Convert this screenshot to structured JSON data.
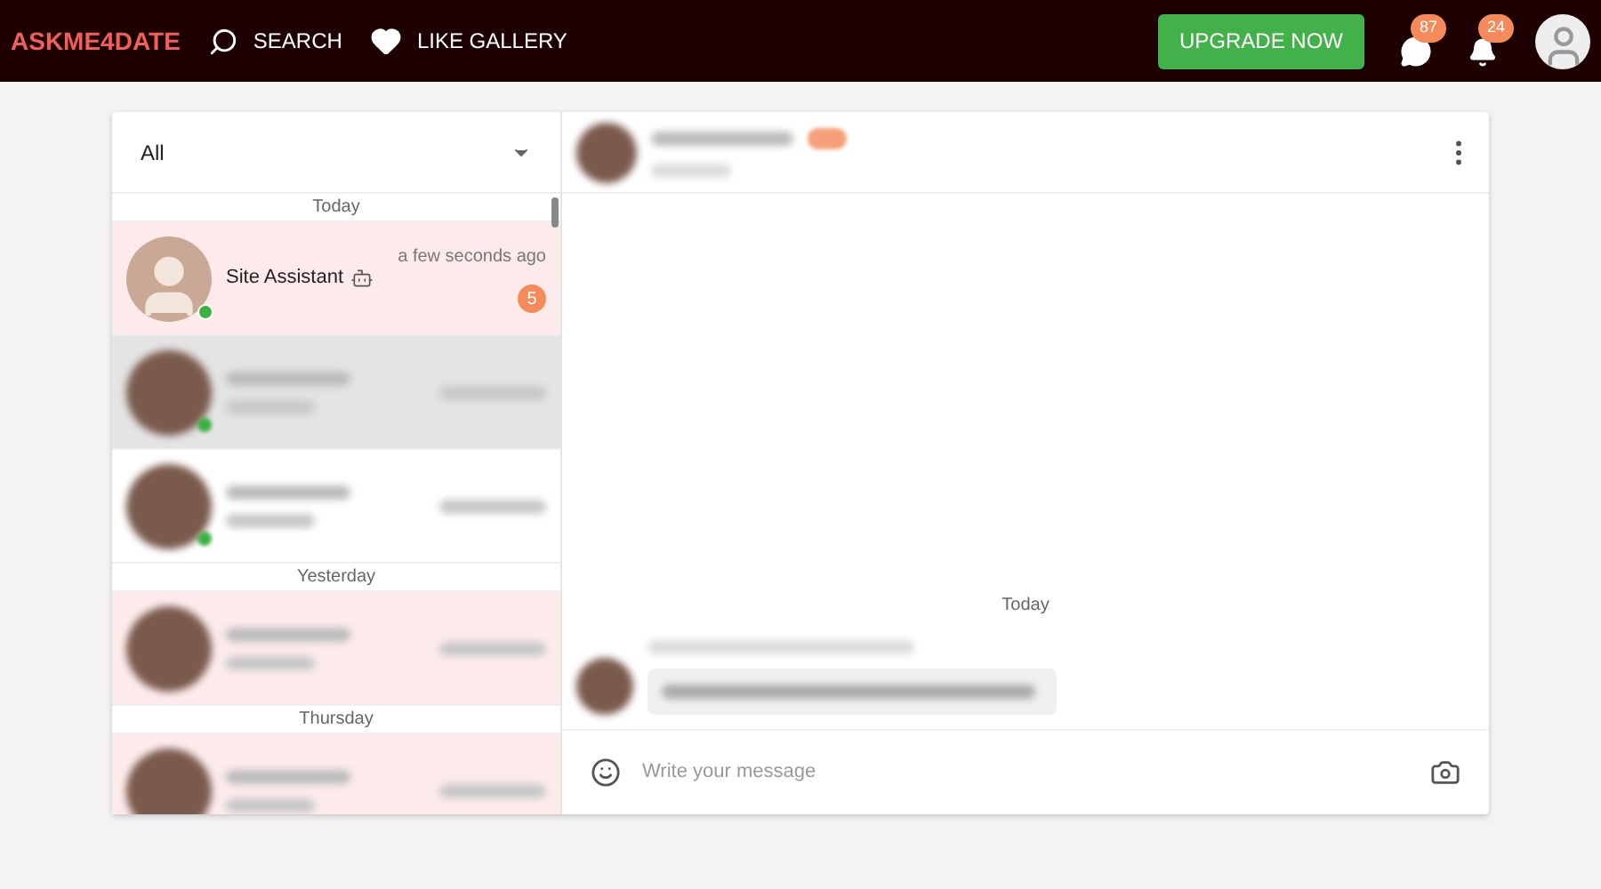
{
  "header": {
    "logo": "ASKME4DATE",
    "nav": [
      {
        "label": "SEARCH",
        "kind": "search"
      },
      {
        "label": "LIKE GALLERY",
        "kind": "heart"
      }
    ],
    "upgrade": "UPGRADE NOW",
    "messages_count": "87",
    "notifications_count": "24"
  },
  "filter": {
    "value": "All"
  },
  "groups": [
    {
      "label": "Today",
      "items": [
        {
          "kind": "contact",
          "name": "Site Assistant",
          "time": "a few seconds ago",
          "unread": "5",
          "online": true,
          "unread_tint": true,
          "bot": true
        },
        {
          "kind": "blurred",
          "selected": true,
          "online": true
        },
        {
          "kind": "blurred",
          "selected": false,
          "unread_tint": false,
          "online": true
        }
      ]
    },
    {
      "label": "Yesterday",
      "items": [
        {
          "kind": "blurred",
          "selected": false,
          "unread_tint": true,
          "online": false
        }
      ]
    },
    {
      "label": "Thursday",
      "items": [
        {
          "kind": "blurred",
          "selected": false,
          "unread_tint": true,
          "online": false
        }
      ]
    }
  ],
  "chat": {
    "day_label": "Today",
    "composer": {
      "placeholder": "Write your message"
    }
  }
}
